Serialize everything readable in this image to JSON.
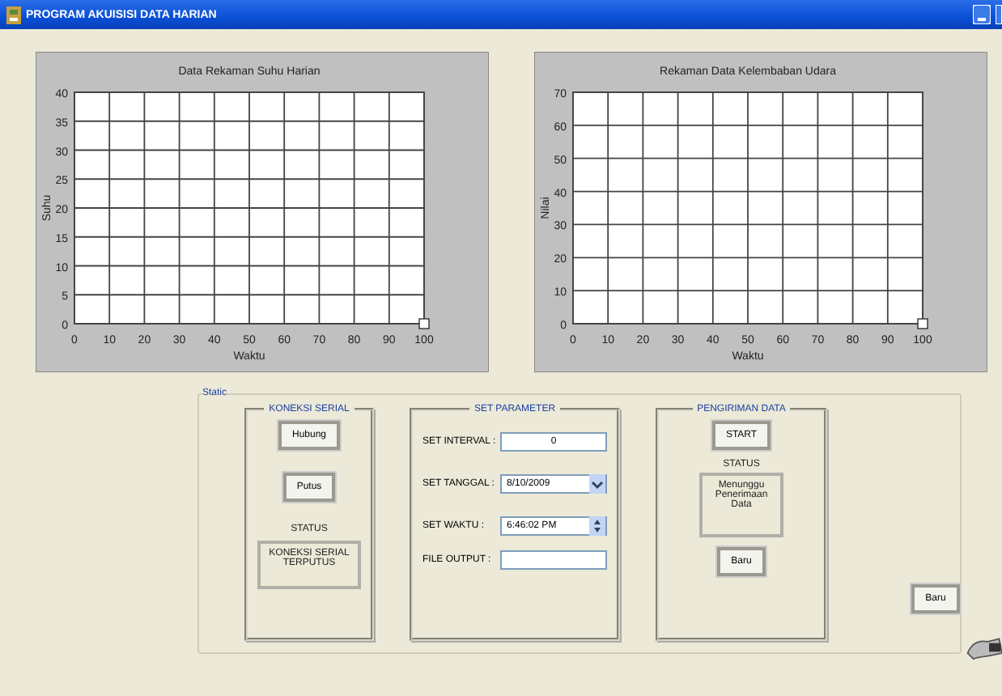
{
  "window": {
    "title": "PROGRAM AKUISISI DATA HARIAN"
  },
  "charts": [
    {
      "chart_data": {
        "type": "line",
        "grid": true,
        "title": "Data Rekaman Suhu Harian",
        "xlabel": "Waktu",
        "ylabel": "Suhu",
        "xlim": [
          0,
          100
        ],
        "ylim": [
          0,
          40
        ],
        "xticks": [
          0,
          10,
          20,
          30,
          40,
          50,
          60,
          70,
          80,
          90,
          100
        ],
        "yticks": [
          0,
          5,
          10,
          15,
          20,
          25,
          30,
          35,
          40
        ]
      }
    },
    {
      "chart_data": {
        "type": "line",
        "grid": true,
        "title": "Rekaman Data Kelembaban Udara",
        "xlabel": "Waktu",
        "ylabel": "Nilai",
        "xlim": [
          0,
          100
        ],
        "ylim": [
          0,
          70
        ],
        "xticks": [
          0,
          10,
          20,
          30,
          40,
          50,
          60,
          70,
          80,
          90,
          100
        ],
        "yticks": [
          0,
          10,
          20,
          30,
          40,
          50,
          60,
          70
        ]
      }
    }
  ],
  "frame": {
    "label": "Static"
  },
  "koneksi": {
    "title": "KONEKSI SERIAL",
    "buttons": [
      "Hubung",
      "Putus"
    ],
    "status_label": "STATUS",
    "status_text": "KONEKSI SERIAL TERPUTUS"
  },
  "parameters": {
    "title": "SET PARAMETER",
    "fields": [
      {
        "kind": "text",
        "label": "SET INTERVAL :",
        "value": "0"
      },
      {
        "kind": "dropdown",
        "label": "SET TANGGAL :",
        "value": "8/10/2009"
      },
      {
        "kind": "spinner",
        "label": "SET WAKTU :",
        "value": "6:46:02 PM"
      },
      {
        "kind": "text",
        "label": "FILE OUTPUT :"
      }
    ]
  },
  "pengiriman": {
    "title": "PENGIRIMAN DATA",
    "start_button": "START",
    "status_label": "STATUS",
    "status_text": "Menunggu Penerimaan Data",
    "button": "Baru"
  },
  "side_button": "Baru"
}
